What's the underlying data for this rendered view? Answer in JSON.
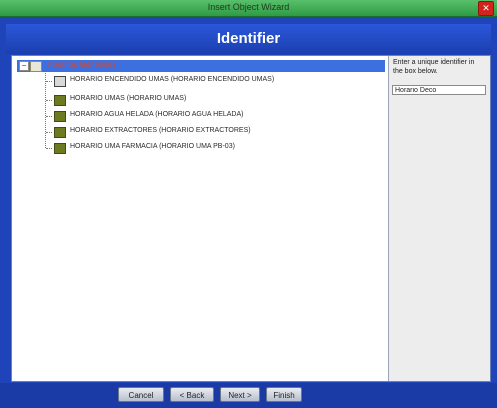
{
  "window": {
    "title": "Insert Object Wizard",
    "close_glyph": "✕"
  },
  "header": {
    "title": "Identifier"
  },
  "tree": {
    "root": {
      "label": "Horarios Generales",
      "expander": "−"
    },
    "items": [
      {
        "label": "HORARIO ENCENDIDO UMAS (HORARIO ENCENDIDO UMAS)",
        "icon": "schedule-doc-icon"
      },
      {
        "label": "HORARIO UMAS (HORARIO UMAS)",
        "icon": "schedule-icon"
      },
      {
        "label": "HORARIO AGUA HELADA (HORARIO AGUA HELADA)",
        "icon": "schedule-icon"
      },
      {
        "label": "HORARIO EXTRACTORES (HORARIO EXTRACTORES)",
        "icon": "schedule-icon"
      },
      {
        "label": "HORARIO UMA FARMACIA (HORARIO UMA PB-03)",
        "icon": "schedule-icon"
      }
    ]
  },
  "side": {
    "instruction": "Enter a unique identifier in the box below.",
    "identifier_value": "Horario Deco"
  },
  "footer": {
    "buttons": [
      {
        "label": "Cancel"
      },
      {
        "label": "< Back"
      },
      {
        "label": "Next >"
      },
      {
        "label": "Finish"
      }
    ]
  },
  "colors": {
    "window_blue": "#1f43b8",
    "selection_blue": "#3e6fe0",
    "titlebar_green": "#3aa851",
    "root_label": "#d54a2a"
  }
}
